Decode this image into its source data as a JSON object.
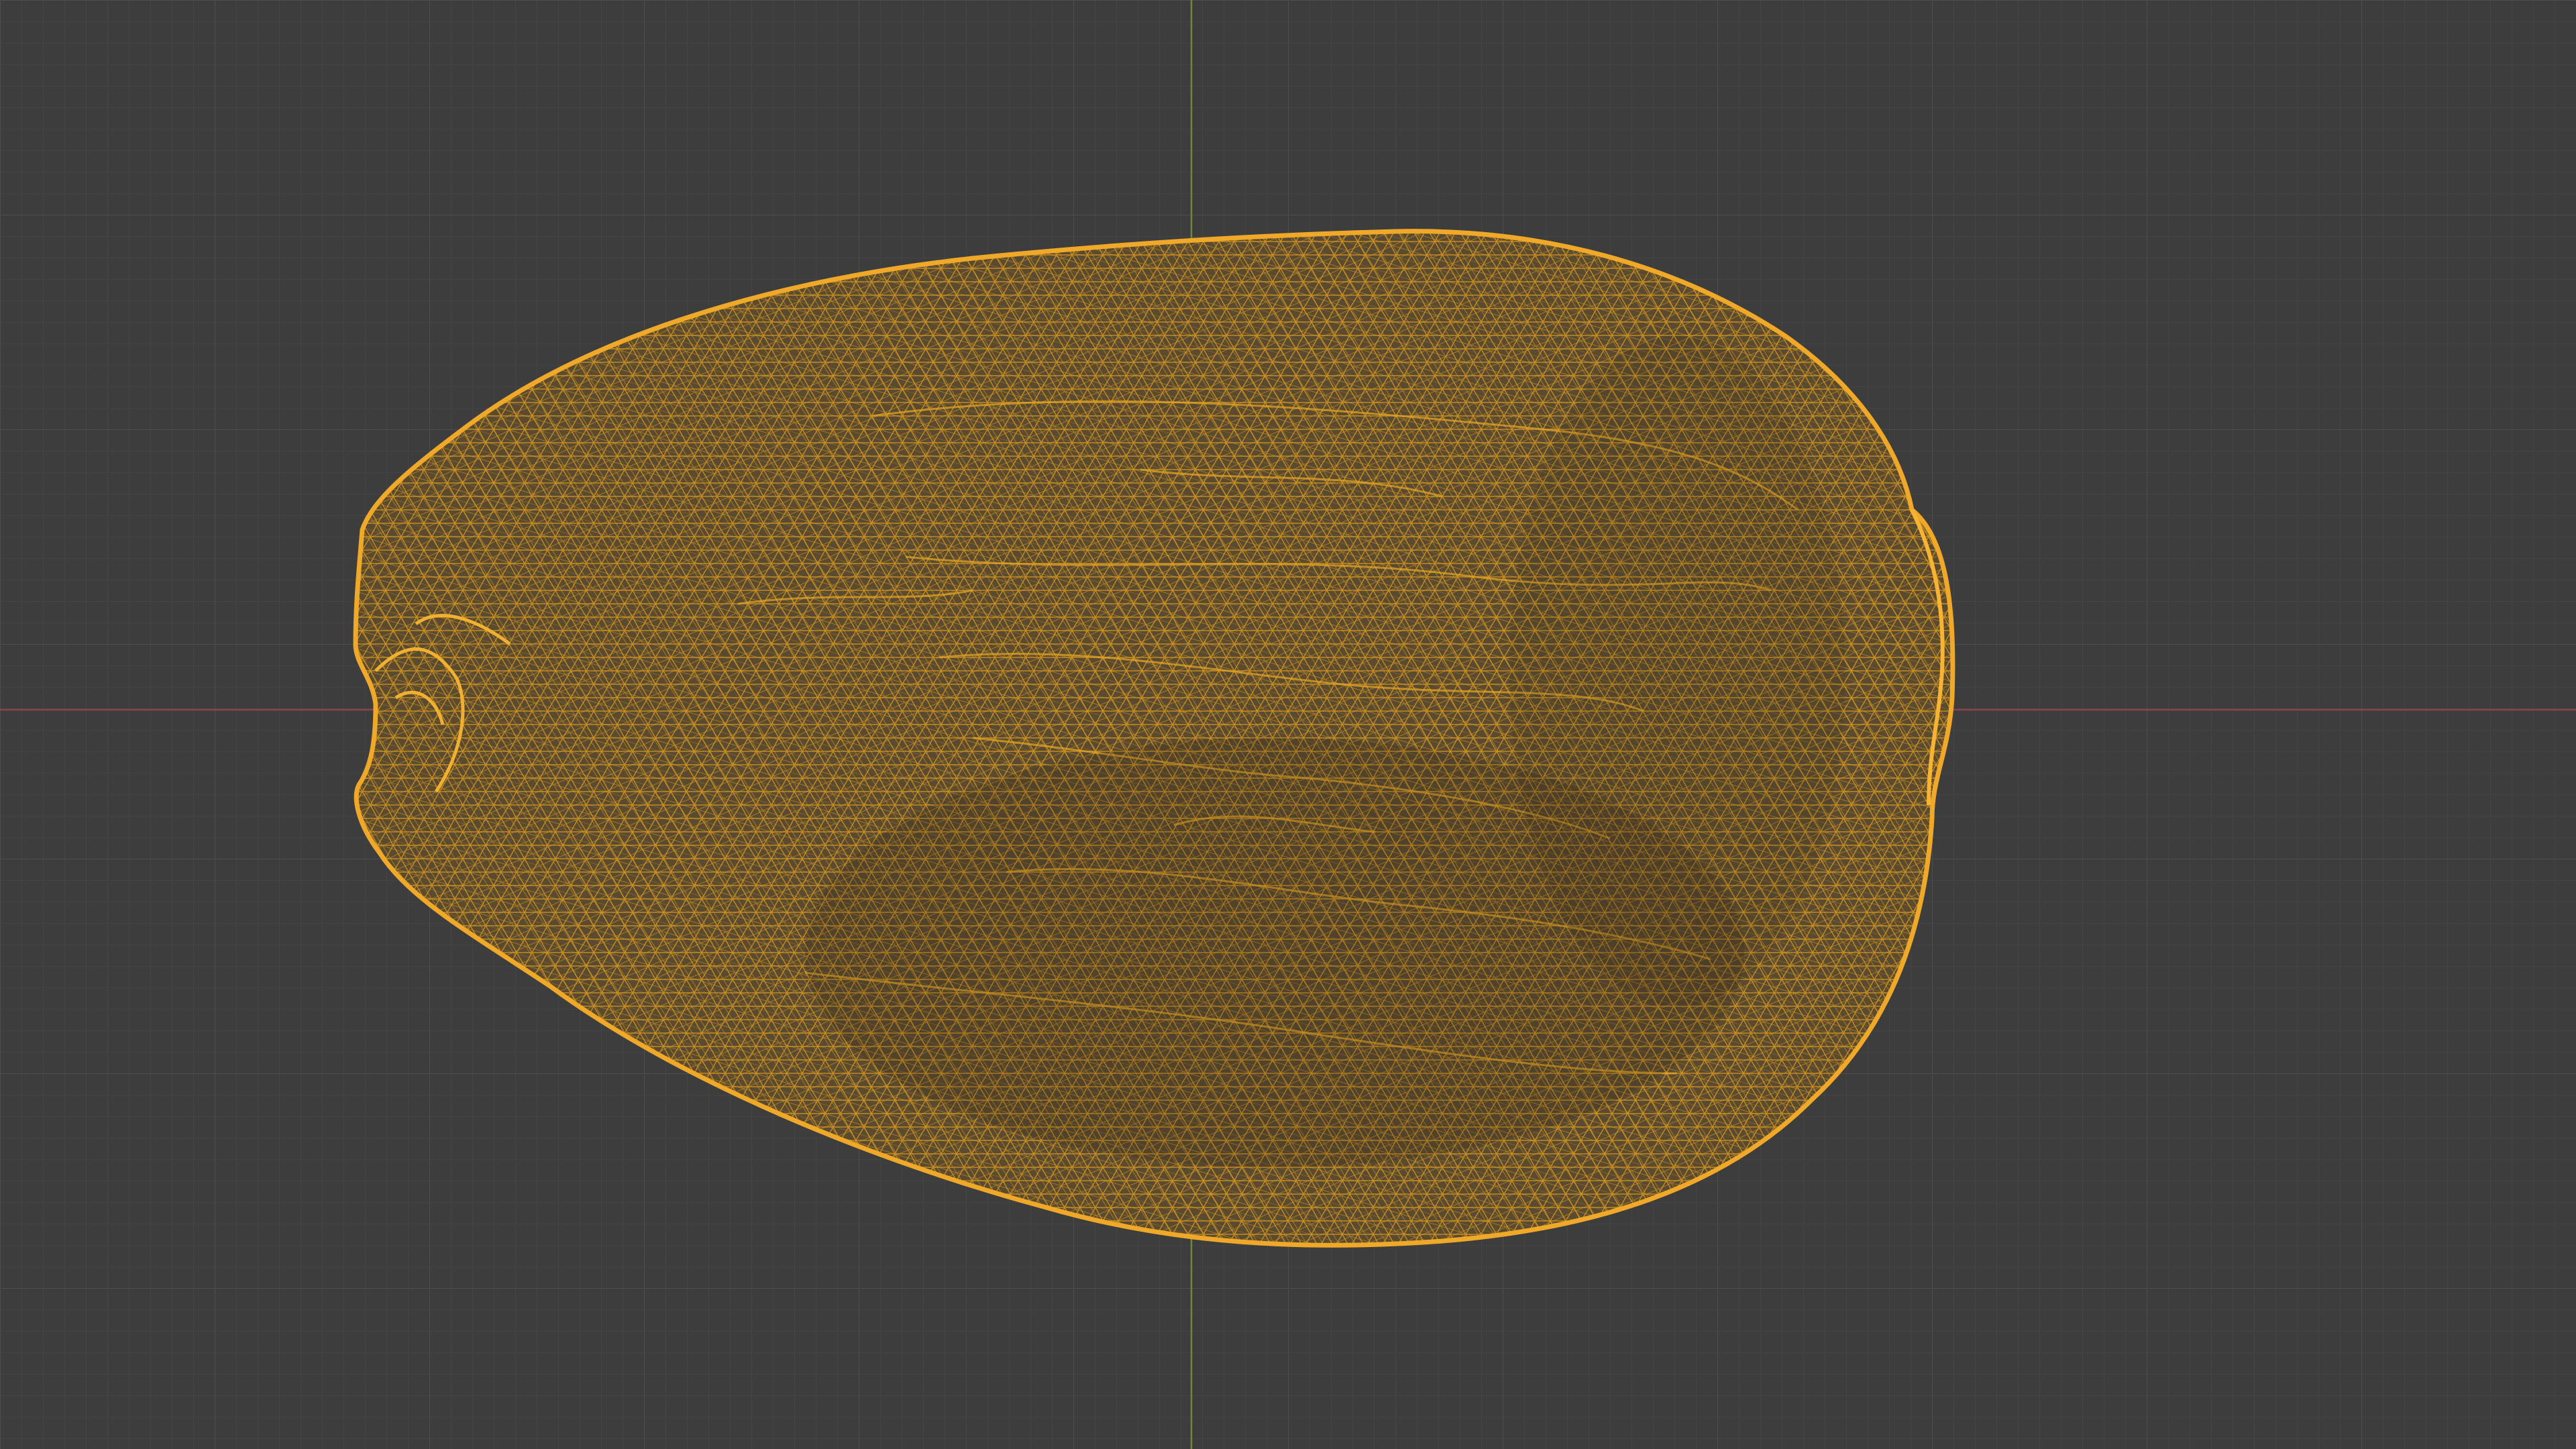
{
  "viewport": {
    "background_color": "#3d3d3d",
    "grid": {
      "enabled": true,
      "minor_color": "#464646",
      "major_color": "#4e4e4e"
    },
    "axes": {
      "x_axis_color": "#8a4450",
      "y_axis_color": "#6a8a3a"
    },
    "object": {
      "display_mode": "wireframe",
      "selected": true,
      "wire_color": "#e4a020",
      "fill_color": "#705020",
      "icon": "mesh-object-icon"
    }
  }
}
